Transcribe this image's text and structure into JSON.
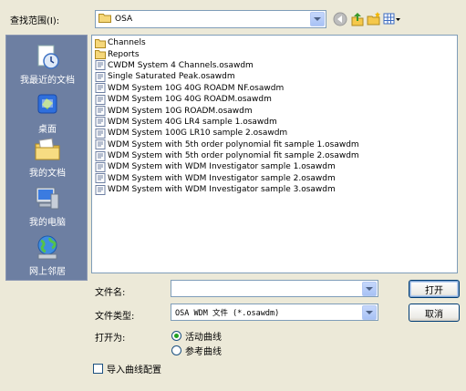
{
  "lookin": {
    "label": "查找范围(I):",
    "value": "OSA"
  },
  "places": [
    {
      "name": "recent",
      "label": "我最近的文档",
      "icon": "recent-documents-icon"
    },
    {
      "name": "desktop",
      "label": "桌面",
      "icon": "desktop-icon"
    },
    {
      "name": "mydocs",
      "label": "我的文档",
      "icon": "my-documents-icon"
    },
    {
      "name": "mycomputer",
      "label": "我的电脑",
      "icon": "my-computer-icon"
    },
    {
      "name": "network",
      "label": "网上邻居",
      "icon": "network-places-icon"
    }
  ],
  "files": [
    {
      "type": "folder",
      "name": "Channels"
    },
    {
      "type": "folder",
      "name": "Reports"
    },
    {
      "type": "file",
      "name": "CWDM System 4 Channels.osawdm"
    },
    {
      "type": "file",
      "name": "Single Saturated Peak.osawdm"
    },
    {
      "type": "file",
      "name": "WDM System 10G 40G ROADM NF.osawdm"
    },
    {
      "type": "file",
      "name": "WDM System 10G 40G ROADM.osawdm"
    },
    {
      "type": "file",
      "name": "WDM System 10G ROADM.osawdm"
    },
    {
      "type": "file",
      "name": "WDM System 40G LR4 sample 1.osawdm"
    },
    {
      "type": "file",
      "name": "WDM System 100G LR10 sample 2.osawdm"
    },
    {
      "type": "file",
      "name": "WDM System with 5th order polynomial fit sample 1.osawdm"
    },
    {
      "type": "file",
      "name": "WDM System with 5th order polynomial fit sample 2.osawdm"
    },
    {
      "type": "file",
      "name": "WDM System with WDM Investigator sample 1.osawdm"
    },
    {
      "type": "file",
      "name": "WDM System with WDM Investigator sample 2.osawdm"
    },
    {
      "type": "file",
      "name": "WDM System with WDM Investigator sample 3.osawdm"
    }
  ],
  "filename": {
    "label": "文件名:",
    "value": ""
  },
  "filetype": {
    "label": "文件类型:",
    "value": "OSA WDM 文件 (*.osawdm)"
  },
  "buttons": {
    "open": "打开",
    "cancel": "取消"
  },
  "openas": {
    "label": "打开为:",
    "options": [
      {
        "label": "活动曲线",
        "selected": true
      },
      {
        "label": "参考曲线",
        "selected": false
      }
    ]
  },
  "import_config": {
    "label": "导入曲线配置",
    "checked": false
  },
  "colors": {
    "window": "#ece9d8",
    "places_bar": "#6d7fa2",
    "border": "#7f9db9"
  }
}
